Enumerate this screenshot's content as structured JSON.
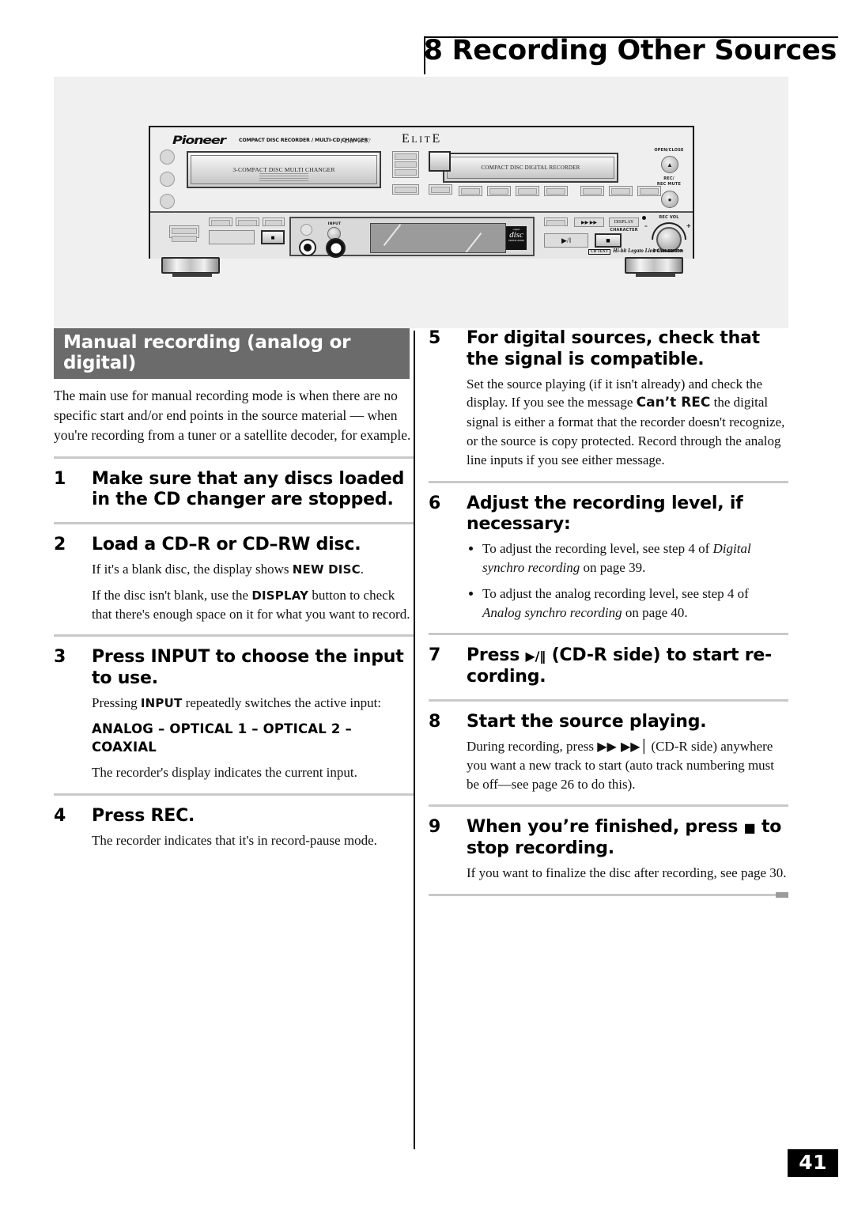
{
  "header": {
    "chapter_title": "8 Recording Other Sources"
  },
  "illustration": {
    "brand": "Pioneer",
    "model_line": "COMPACT DISC RECORDER / MULTI-CD CHANGER",
    "model_number": "PDR-W37",
    "series_mark": "ELITE",
    "changer_tray_label": "3-COMPACT DISC MULTI CHANGER",
    "recorder_tray_label": "COMPACT DISC DIGITAL RECORDER",
    "open_close_label": "OPEN/CLOSE",
    "rec_mute_label": "REC/\nREC MUTE",
    "rec_mute_line1": "REC/",
    "rec_mute_line2": "REC MUTE",
    "rec_vol_label": "REC VOL",
    "rec_vol_minus": "–",
    "rec_vol_plus": "+",
    "push_enter_label": "PUSH ENTER",
    "display_label": "DISPLAY",
    "character_label": "CHARACTER",
    "input_label": "INPUT",
    "skip_button_label": "▶▶ ▶▶",
    "play_pause_label": "▶/‖",
    "stop_label": "■",
    "cd_logo_text": "disc",
    "cd_logo_top": "compact",
    "cd_logo_bottom": "DIGITAL AUDIO",
    "legato_badge": "CD TEXT",
    "legato_text": "Hi-bit Legato Link Conversion"
  },
  "section": {
    "banner_title": "Manual recording (analog or digital)",
    "intro": "The main use for manual recording mode is when there are no specific start and/or end points in the source material — when you're recording from a tuner or a satellite decoder, for example."
  },
  "steps_left": [
    {
      "num": "1",
      "title": "Make sure that any discs loaded in the CD changer are stopped.",
      "body": []
    },
    {
      "num": "2",
      "title": "Load a CD–R or CD–RW disc.",
      "body_p1_a": "If it's a blank disc, the display shows ",
      "body_p1_b": "NEW DISC",
      "body_p1_c": ".",
      "body_p2_a": "If the disc isn't blank, use the ",
      "body_p2_b": "DISPLAY",
      "body_p2_c": " button to check that there's enough space on it for what you want to record."
    },
    {
      "num": "3",
      "title": "Press INPUT to choose the input to use.",
      "body_p1_a": "Pressing ",
      "body_p1_b": "INPUT",
      "body_p1_c": " repeatedly switches the active input:",
      "input_sequence": "ANALOG – OPTICAL 1 – OPTICAL 2 – COAXIAL",
      "body_p3": "The recorder's display indicates the current input."
    },
    {
      "num": "4",
      "title": "Press REC.",
      "body_p1": "The recorder indicates that it's in record-pause mode."
    }
  ],
  "steps_right": [
    {
      "num": "5",
      "title": "For digital sources, check that the signal is compatible.",
      "body_a": "Set the source playing (if it isn't already) and check the display. If you see the message ",
      "body_b": "Can’t REC",
      "body_c": " the digital signal is either a format that the recorder doesn't recognize, or the source is copy protected. Record through the analog line inputs if you see either message."
    },
    {
      "num": "6",
      "title": "Adjust the recording level, if necessary:",
      "bullet1_a": "To adjust the recording level, see step 4 of ",
      "bullet1_it": "Digital synchro recording",
      "bullet1_b": " on page 39.",
      "bullet2_a": "To adjust the analog recording level, see step 4 of ",
      "bullet2_it": "Analog synchro recording",
      "bullet2_b": " on page 40."
    },
    {
      "num": "7",
      "title_a": "Press ",
      "title_glyph": "▶/‖",
      "title_b": " (CD-R side) to start re-cording."
    },
    {
      "num": "8",
      "title": "Start the source playing.",
      "body_a": "During recording, press ",
      "body_glyph": "▶▶ ▶▶│",
      "body_b": " (CD-R side) anywhere you want a new track to start (auto track numbering must be off—see page 26 to do this)."
    },
    {
      "num": "9",
      "title_a": "When you’re finished, press ",
      "title_glyph": "■",
      "title_b": " to stop recording.",
      "body_p1": "If you want to finalize the disc after recording, see page 30."
    }
  ],
  "footer": {
    "page_number": "41"
  }
}
